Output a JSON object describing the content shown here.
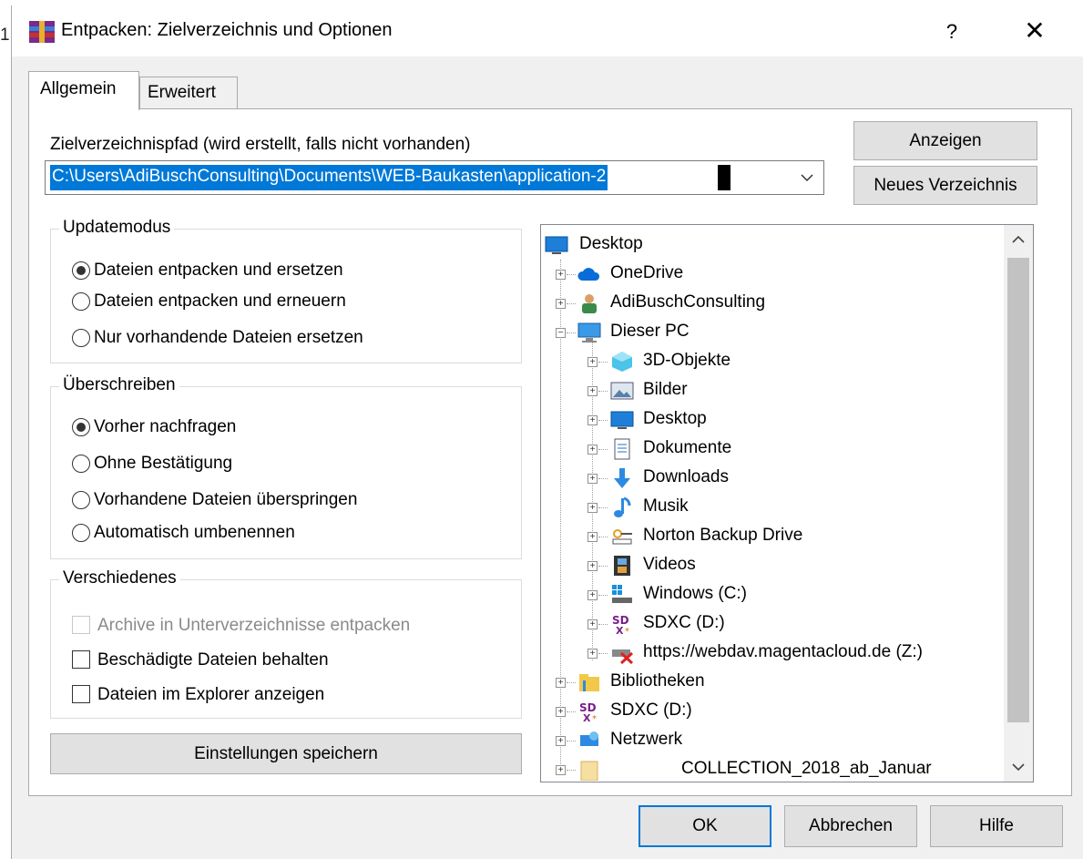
{
  "window": {
    "title": "Entpacken: Zielverzeichnis und Optionen",
    "help": "?",
    "close": "✕"
  },
  "background": {
    "row_number": "1"
  },
  "tabs": [
    {
      "label": "Allgemein"
    },
    {
      "label": "Erweitert"
    }
  ],
  "path": {
    "label": "Zielverzeichnispfad (wird erstellt, falls nicht vorhanden)",
    "value": "C:\\Users\\AdiBuschConsulting\\Documents\\WEB-Baukasten\\application-2"
  },
  "buttons": {
    "show": "Anzeigen",
    "new_folder": "Neues Verzeichnis",
    "save_settings": "Einstellungen speichern",
    "ok": "OK",
    "cancel": "Abbrechen",
    "help": "Hilfe"
  },
  "update_mode": {
    "title": "Updatemodus",
    "options": [
      {
        "label": "Dateien entpacken und ersetzen",
        "checked": true
      },
      {
        "label": "Dateien entpacken und erneuern",
        "checked": false
      },
      {
        "label": "Nur vorhandende Dateien ersetzen",
        "checked": false
      }
    ]
  },
  "overwrite": {
    "title": "Überschreiben",
    "options": [
      {
        "label": "Vorher nachfragen",
        "checked": true
      },
      {
        "label": "Ohne Bestätigung",
        "checked": false
      },
      {
        "label": "Vorhandene Dateien überspringen",
        "checked": false
      },
      {
        "label": "Automatisch umbenennen",
        "checked": false
      }
    ]
  },
  "misc": {
    "title": "Verschiedenes",
    "options": [
      {
        "label": "Archive in Unterverzeichnisse entpacken",
        "checked": false,
        "disabled": true
      },
      {
        "label": "Beschädigte Dateien behalten",
        "checked": false,
        "disabled": false
      },
      {
        "label": "Dateien im Explorer anzeigen",
        "checked": false,
        "disabled": false
      }
    ]
  },
  "tree": {
    "items": [
      {
        "label": "Desktop",
        "icon": "desktop-icon"
      },
      {
        "label": "OneDrive",
        "icon": "cloud-icon"
      },
      {
        "label": "AdiBuschConsulting",
        "icon": "user-icon"
      },
      {
        "label": "Dieser PC",
        "icon": "computer-icon"
      },
      {
        "label": "3D-Objekte",
        "icon": "cube-icon"
      },
      {
        "label": "Bilder",
        "icon": "pictures-icon"
      },
      {
        "label": "Desktop",
        "icon": "desktop-icon"
      },
      {
        "label": "Dokumente",
        "icon": "document-icon"
      },
      {
        "label": "Downloads",
        "icon": "download-icon"
      },
      {
        "label": "Musik",
        "icon": "music-icon"
      },
      {
        "label": "Norton Backup Drive",
        "icon": "backup-drive-icon"
      },
      {
        "label": "Videos",
        "icon": "video-icon"
      },
      {
        "label": "Windows (C:)",
        "icon": "windows-drive-icon"
      },
      {
        "label": "SDXC (D:)",
        "icon": "sd-card-icon"
      },
      {
        "label": "https://webdav.magentacloud.de (Z:)",
        "icon": "network-drive-disconnected-icon"
      },
      {
        "label": "Bibliotheken",
        "icon": "libraries-icon"
      },
      {
        "label": "SDXC (D:)",
        "icon": "sd-card-icon"
      },
      {
        "label": "Netzwerk",
        "icon": "network-icon"
      },
      {
        "label": "COLLECTION_2018_ab_Januar",
        "icon": "folder-icon"
      }
    ]
  },
  "colors": {
    "accent": "#0078d7",
    "dialog_bg": "#f0f0f0"
  }
}
